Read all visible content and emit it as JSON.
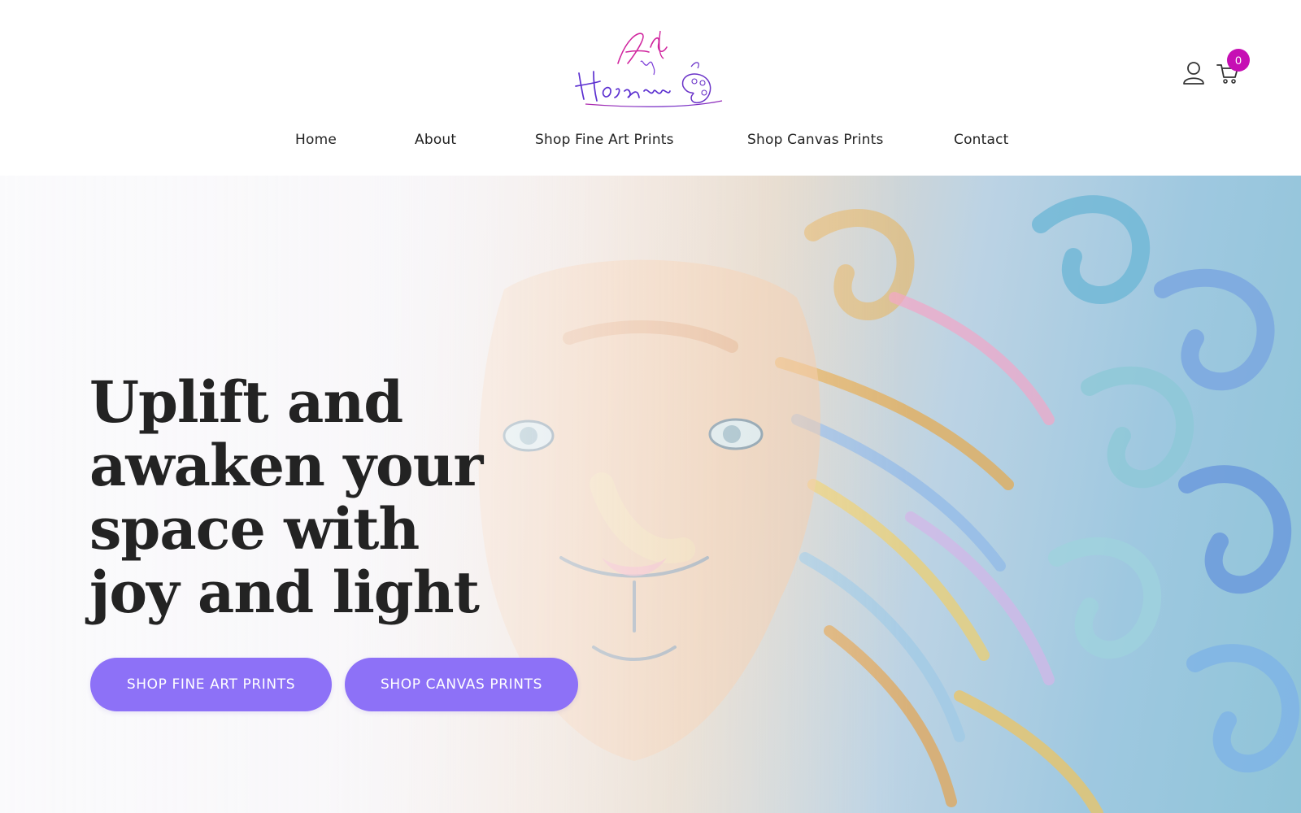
{
  "header": {
    "logo": {
      "text_line1": "Art",
      "text_line2": "by",
      "text_line3": "Hosanna",
      "icon": "palette-icon",
      "colors": {
        "pink": "#d0249e",
        "purple": "#6a32c8"
      }
    },
    "icons": {
      "account": "user-icon",
      "cart": "cart-icon",
      "cart_count": "0",
      "badge_color": "#c60fb4"
    },
    "nav": [
      {
        "label": "Home"
      },
      {
        "label": "About"
      },
      {
        "label": "Shop Fine Art Prints"
      },
      {
        "label": "Shop Canvas Prints"
      },
      {
        "label": "Contact"
      }
    ]
  },
  "hero": {
    "heading": "Uplift and awaken your space with joy and light",
    "image_subject": "lion-painting",
    "buttons": [
      {
        "label": "SHOP FINE ART PRINTS"
      },
      {
        "label": "SHOP CANVAS PRINTS"
      }
    ],
    "button_color": "#8d71f7"
  }
}
